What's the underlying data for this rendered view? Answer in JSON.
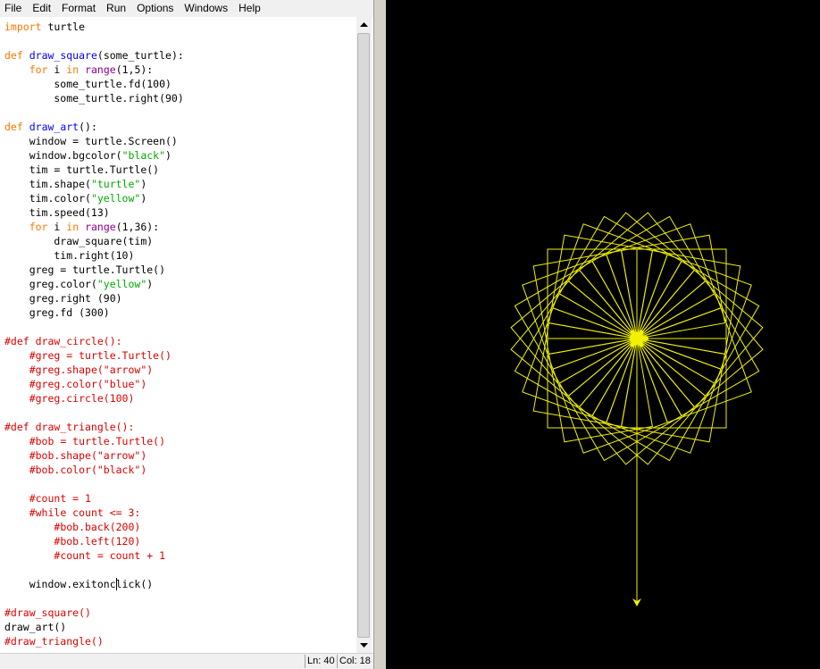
{
  "menubar": {
    "items": [
      "File",
      "Edit",
      "Format",
      "Run",
      "Options",
      "Windows",
      "Help"
    ]
  },
  "editor": {
    "lines": [
      [
        {
          "t": "import",
          "c": "kw"
        },
        {
          "t": " turtle"
        }
      ],
      [],
      [
        {
          "t": "def",
          "c": "kw"
        },
        {
          "t": " "
        },
        {
          "t": "draw_square",
          "c": "def"
        },
        {
          "t": "(some_turtle):"
        }
      ],
      [
        {
          "t": "    "
        },
        {
          "t": "for",
          "c": "kw"
        },
        {
          "t": " i "
        },
        {
          "t": "in",
          "c": "kw"
        },
        {
          "t": " "
        },
        {
          "t": "range",
          "c": "bi"
        },
        {
          "t": "(1,5):"
        }
      ],
      [
        {
          "t": "        some_turtle.fd(100)"
        }
      ],
      [
        {
          "t": "        some_turtle.right(90)"
        }
      ],
      [],
      [
        {
          "t": "def",
          "c": "kw"
        },
        {
          "t": " "
        },
        {
          "t": "draw_art",
          "c": "def"
        },
        {
          "t": "():"
        }
      ],
      [
        {
          "t": "    window = turtle.Screen()"
        }
      ],
      [
        {
          "t": "    window.bgcolor("
        },
        {
          "t": "\"black\"",
          "c": "str"
        },
        {
          "t": ")"
        }
      ],
      [
        {
          "t": "    tim = turtle.Turtle()"
        }
      ],
      [
        {
          "t": "    tim.shape("
        },
        {
          "t": "\"turtle\"",
          "c": "str"
        },
        {
          "t": ")"
        }
      ],
      [
        {
          "t": "    tim.color("
        },
        {
          "t": "\"yellow\"",
          "c": "str"
        },
        {
          "t": ")"
        }
      ],
      [
        {
          "t": "    tim.speed(13)"
        }
      ],
      [
        {
          "t": "    "
        },
        {
          "t": "for",
          "c": "kw"
        },
        {
          "t": " i "
        },
        {
          "t": "in",
          "c": "kw"
        },
        {
          "t": " "
        },
        {
          "t": "range",
          "c": "bi"
        },
        {
          "t": "(1,36):"
        }
      ],
      [
        {
          "t": "        draw_square(tim)"
        }
      ],
      [
        {
          "t": "        tim.right(10)"
        }
      ],
      [
        {
          "t": "    greg = turtle.Turtle()"
        }
      ],
      [
        {
          "t": "    greg.color("
        },
        {
          "t": "\"yellow\"",
          "c": "str"
        },
        {
          "t": ")"
        }
      ],
      [
        {
          "t": "    greg.right (90)"
        }
      ],
      [
        {
          "t": "    greg.fd (300)"
        }
      ],
      [],
      [
        {
          "t": "#def draw_circle():",
          "c": "com"
        }
      ],
      [
        {
          "t": "    "
        },
        {
          "t": "#greg = turtle.Turtle()",
          "c": "com"
        }
      ],
      [
        {
          "t": "    "
        },
        {
          "t": "#greg.shape(\"arrow\")",
          "c": "com"
        }
      ],
      [
        {
          "t": "    "
        },
        {
          "t": "#greg.color(\"blue\")",
          "c": "com"
        }
      ],
      [
        {
          "t": "    "
        },
        {
          "t": "#greg.circle(100)",
          "c": "com"
        }
      ],
      [],
      [
        {
          "t": "#def draw_triangle():",
          "c": "com"
        }
      ],
      [
        {
          "t": "    "
        },
        {
          "t": "#bob = turtle.Turtle()",
          "c": "com"
        }
      ],
      [
        {
          "t": "    "
        },
        {
          "t": "#bob.shape(\"arrow\")",
          "c": "com"
        }
      ],
      [
        {
          "t": "    "
        },
        {
          "t": "#bob.color(\"black\")",
          "c": "com"
        }
      ],
      [],
      [
        {
          "t": "    "
        },
        {
          "t": "#count = 1",
          "c": "com"
        }
      ],
      [
        {
          "t": "    "
        },
        {
          "t": "#while count <= 3:",
          "c": "com"
        }
      ],
      [
        {
          "t": "        "
        },
        {
          "t": "#bob.back(200)",
          "c": "com"
        }
      ],
      [
        {
          "t": "        "
        },
        {
          "t": "#bob.left(120)",
          "c": "com"
        }
      ],
      [
        {
          "t": "        "
        },
        {
          "t": "#count = count + 1",
          "c": "com"
        }
      ],
      [],
      [
        {
          "t": "    window.exitonc"
        },
        {
          "caret": true
        },
        {
          "t": "lick()"
        }
      ],
      [],
      [
        {
          "t": "#draw_square()",
          "c": "com"
        }
      ],
      [
        {
          "t": "draw_art()"
        }
      ],
      [
        {
          "t": "#draw_triangle()",
          "c": "com"
        }
      ]
    ]
  },
  "statusbar": {
    "line": "Ln: 40",
    "col": "Col: 18"
  },
  "canvas": {
    "background": "#000000",
    "pen_color": "yellow",
    "squares": 35,
    "square_side": 100,
    "turn_per_square_deg": 10,
    "greg_distance": 300
  }
}
